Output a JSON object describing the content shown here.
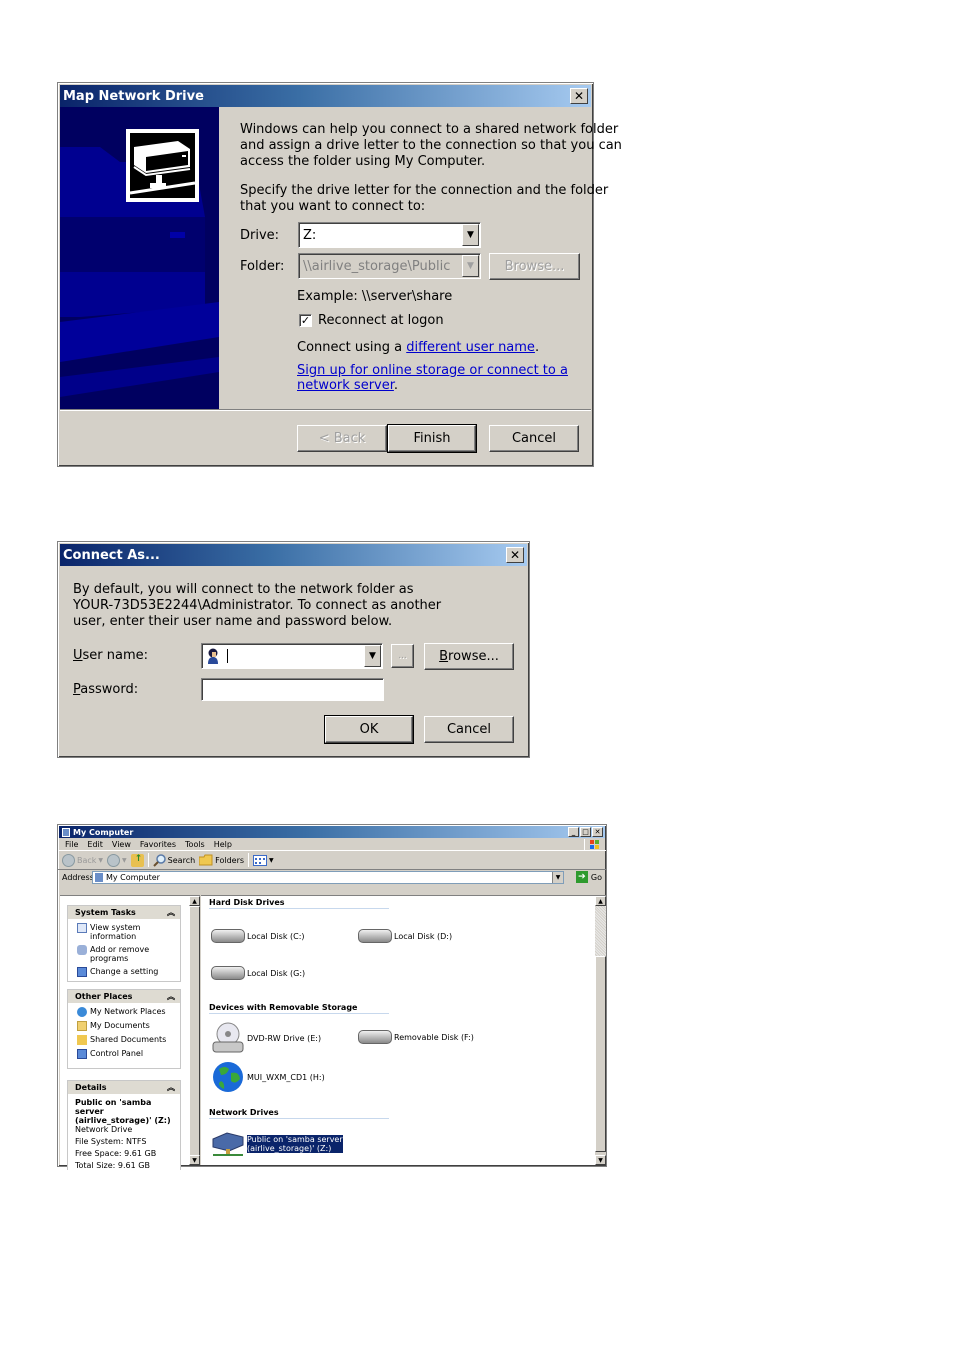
{
  "map_network_drive": {
    "title": "Map Network Drive",
    "close_glyph": "✕",
    "intro": [
      "Windows can help you connect to a shared network folder",
      "and assign a drive letter to the connection so that you can",
      "access the folder using My Computer."
    ],
    "instructions": [
      "Specify the drive letter for the connection and the folder",
      "that you want to connect to:"
    ],
    "drive_label": "Drive:",
    "drive_value": "Z:",
    "folder_label": "Folder:",
    "folder_value": "\\\\airlive_storage\\Public",
    "browse_label": "Browse...",
    "example": "Example: \\\\server\\share",
    "reconnect_label": "Reconnect at logon",
    "reconnect_checked": true,
    "connect_using_prefix": "Connect using a ",
    "connect_using_link": "different user name",
    "connect_using_suffix": ".",
    "signup_link_line1": "Sign up for online storage or connect to a",
    "signup_link_line2": "network server",
    "signup_suffix": ".",
    "back_label": "< Back",
    "finish_label": "Finish",
    "cancel_label": "Cancel"
  },
  "connect_as": {
    "title": "Connect As...",
    "close_glyph": "✕",
    "description": [
      "By default, you will connect to the network folder as",
      "YOUR-73D53E2244\\Administrator. To connect as another",
      "user, enter their user name and password below."
    ],
    "username_label_accel": "U",
    "username_label_rest": "ser name:",
    "username_value": "",
    "ellipsis_label": "...",
    "browse_accel": "B",
    "browse_rest": "rowse...",
    "password_label_accel": "P",
    "password_label_rest": "assword:",
    "password_value": "",
    "ok_label": "OK",
    "cancel_label": "Cancel"
  },
  "my_computer": {
    "title": "My Computer",
    "window_buttons": [
      "_",
      "□",
      "✕"
    ],
    "menu": [
      "File",
      "Edit",
      "View",
      "Favorites",
      "Tools",
      "Help"
    ],
    "toolbar": {
      "back": "Back",
      "search": "Search",
      "folders": "Folders"
    },
    "address_label": "Address",
    "address_value": "My Computer",
    "go_label": "Go",
    "system_tasks": {
      "title": "System Tasks",
      "items": [
        "View system information",
        "Add or remove programs",
        "Change a setting"
      ]
    },
    "other_places": {
      "title": "Other Places",
      "items": [
        "My Network Places",
        "My Documents",
        "Shared Documents",
        "Control Panel"
      ]
    },
    "details": {
      "title": "Details",
      "name": "Public on 'samba server (airlive_storage)' (Z:)",
      "type": "Network Drive",
      "file_system": "File System: NTFS",
      "free_space": "Free Space: 9.61 GB",
      "total_size": "Total Size: 9.61 GB"
    },
    "groups": {
      "hard_disk": "Hard Disk Drives",
      "removable": "Devices with Removable Storage",
      "network": "Network Drives"
    },
    "drives": {
      "c": "Local Disk (C:)",
      "d": "Local Disk (D:)",
      "g": "Local Disk (G:)",
      "e": "DVD-RW Drive (E:)",
      "f": "Removable Disk (F:)",
      "h": "MUI_WXM_CD1 (H:)",
      "z_line1": "Public on 'samba server",
      "z_line2": "(airlive_storage)' (Z:)"
    }
  }
}
